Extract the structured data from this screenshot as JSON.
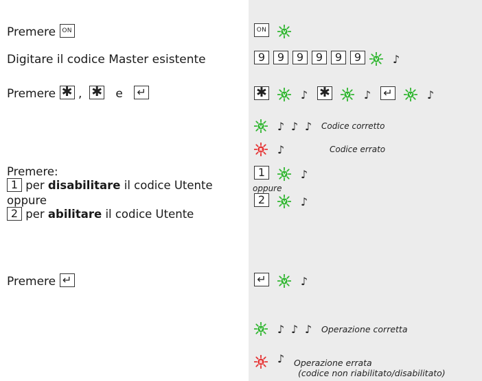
{
  "colors": {
    "panel_bg": "#ececec",
    "led_green": "#2fb52f",
    "led_red": "#e53131",
    "text": "#1a1a1a"
  },
  "steps": {
    "s1": {
      "text": "Premere",
      "key": "ON"
    },
    "s2": {
      "text": "Digitare il codice Master esistente"
    },
    "s3": {
      "text": "Premere",
      "sep1": ",",
      "sep2": "e"
    },
    "s4": {
      "title": "Premere:",
      "key1": "1",
      "pre1": "per",
      "bold1": "disabilitare",
      "post1": "il codice Utente",
      "or": "oppure",
      "key2": "2",
      "pre2": "per",
      "bold2": "abilitare",
      "post2": "il codice Utente"
    },
    "s5": {
      "text": "Premere"
    }
  },
  "panel": {
    "on_key": "ON",
    "code_digits": [
      "9",
      "9",
      "9",
      "9",
      "9",
      "9"
    ],
    "led_green_label": "V",
    "led_red_label": "R",
    "note_symbol": "♪",
    "code_correct": "Codice corretto",
    "code_wrong": "Codice errato",
    "key1": "1",
    "key2": "2",
    "or": "oppure",
    "op_correct": "Operazione corretta",
    "op_wrong_1": "Operazione errata",
    "op_wrong_2": "(codice non riabilitato/disabilitato)"
  }
}
